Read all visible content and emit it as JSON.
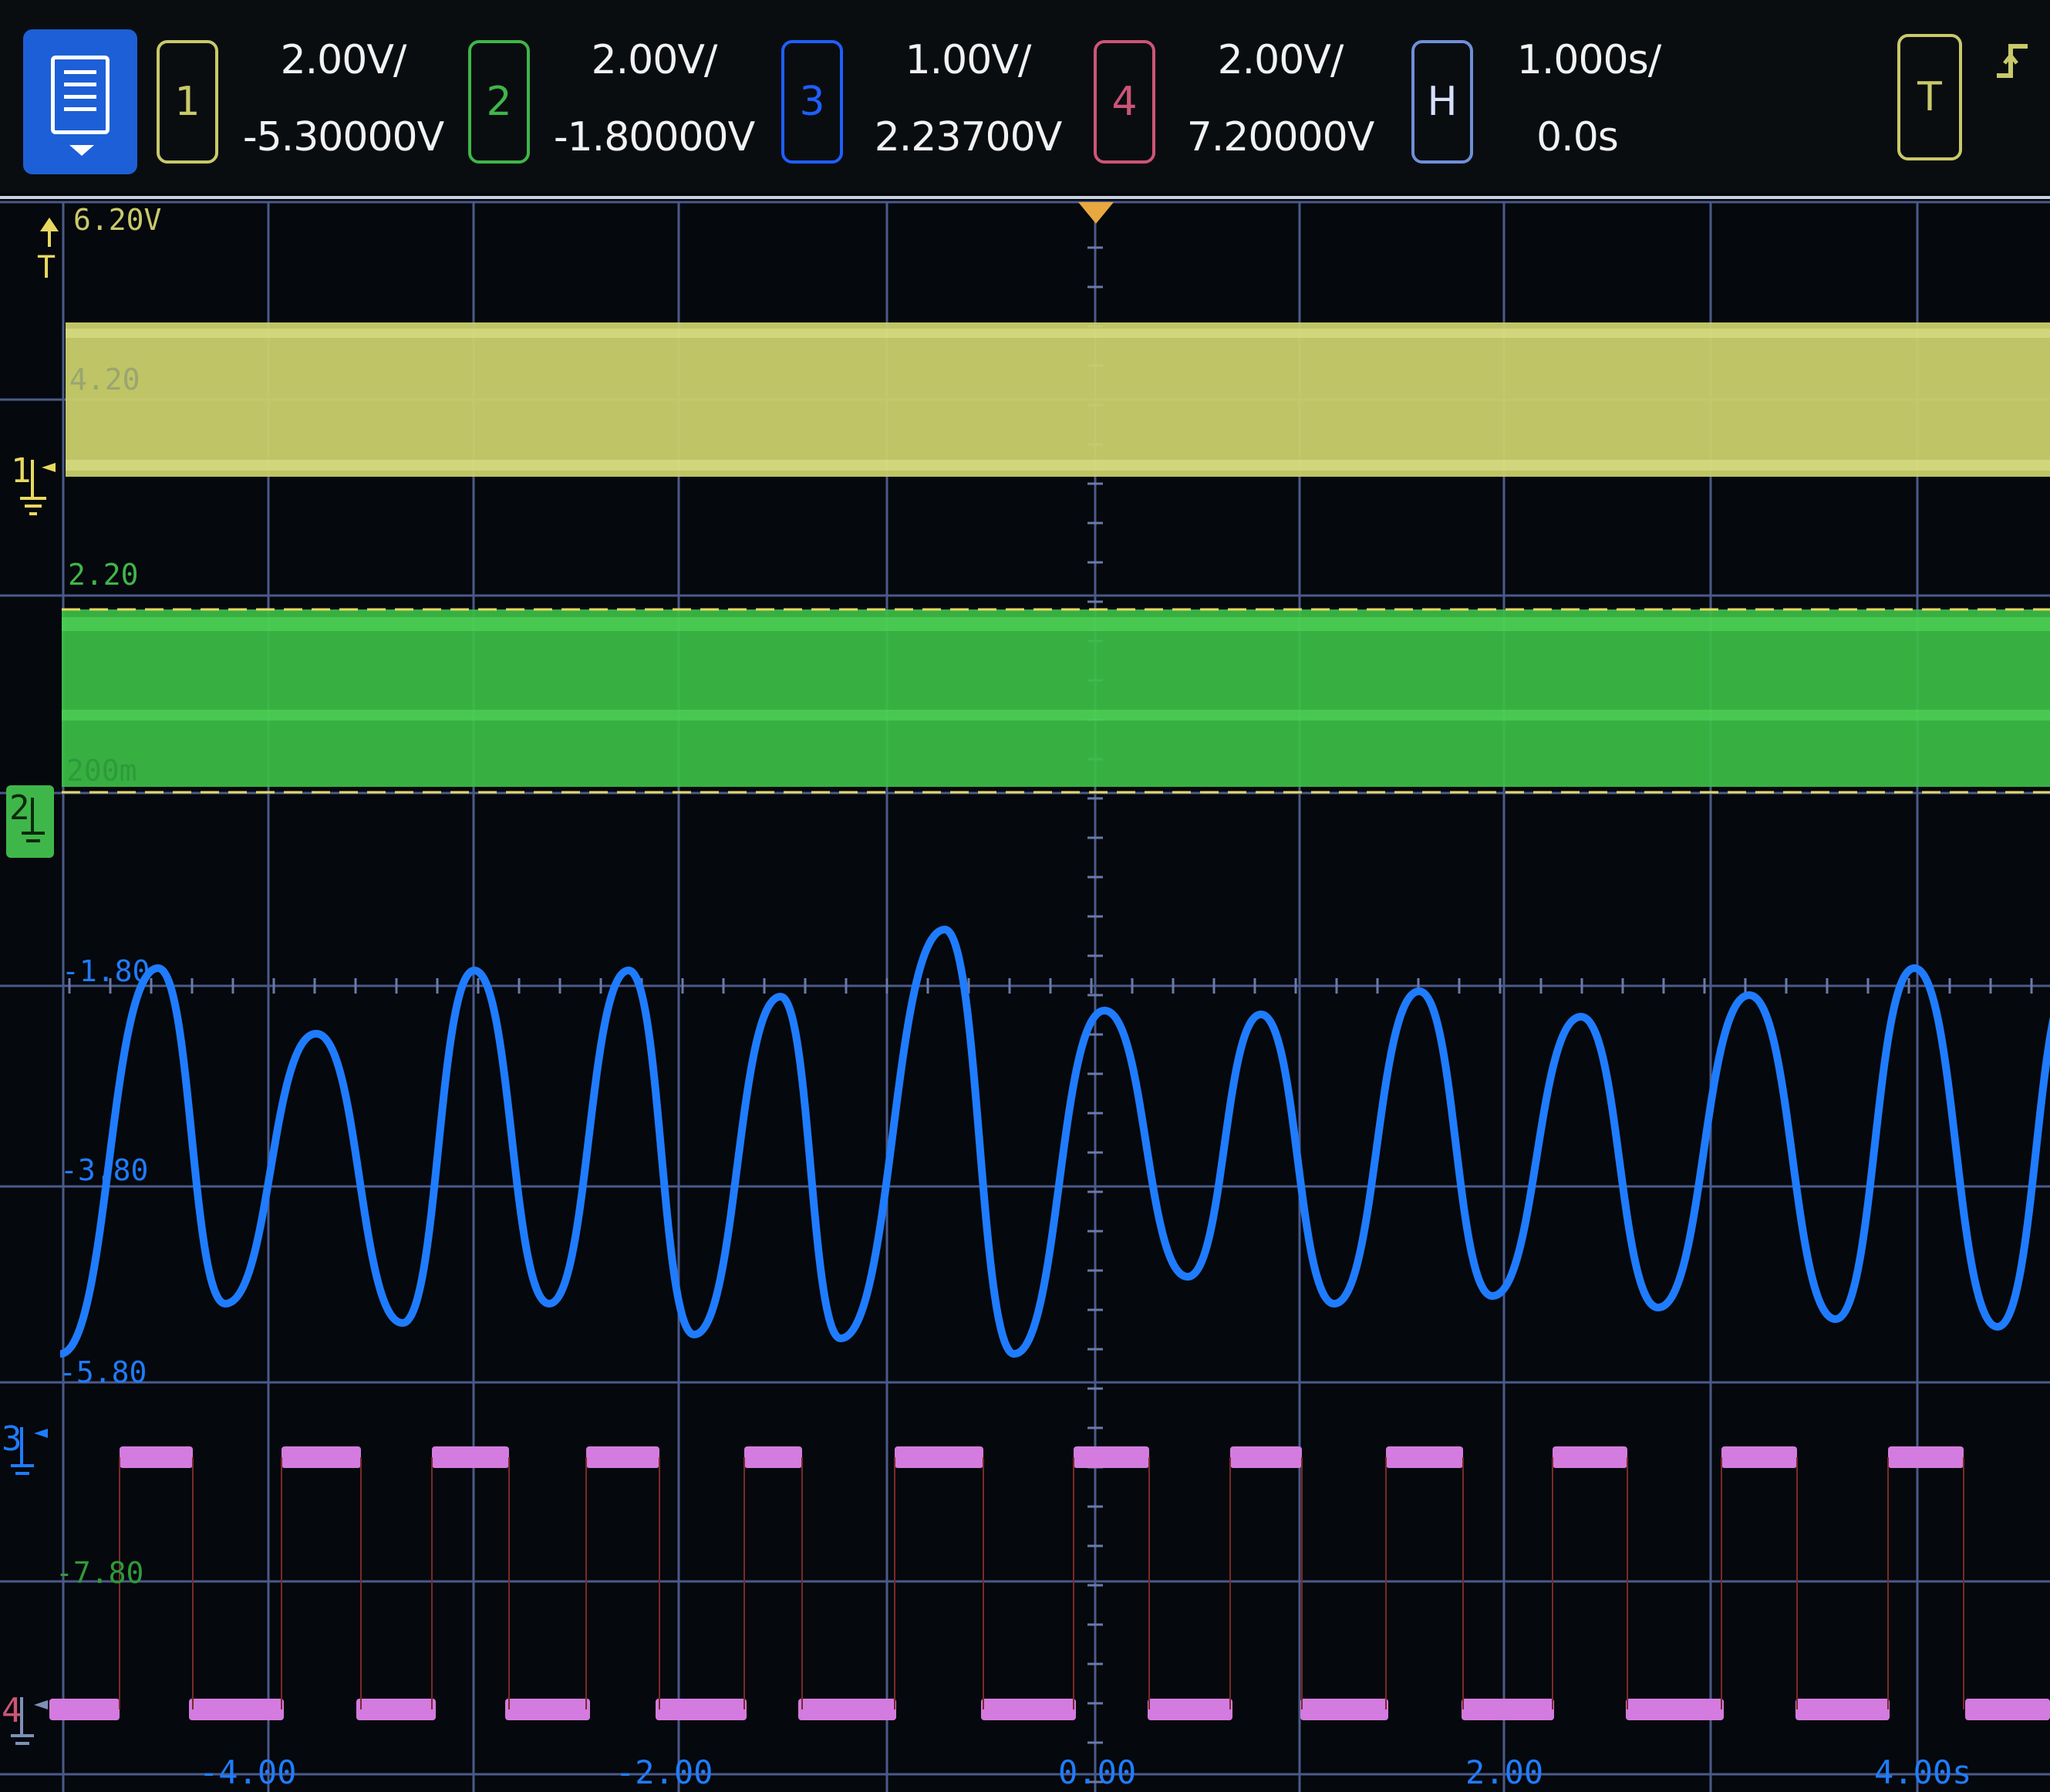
{
  "channels": [
    {
      "id": "1",
      "scale": "2.00V/",
      "offset": "-5.30000V",
      "color": "#c9c96a"
    },
    {
      "id": "2",
      "scale": "2.00V/",
      "offset": "-1.80000V",
      "color": "#3fb64a"
    },
    {
      "id": "3",
      "scale": "1.00V/",
      "offset": "2.23700V",
      "color": "#1f5fff"
    },
    {
      "id": "4",
      "scale": "2.00V/",
      "offset": "7.20000V",
      "color": "#cc5577"
    }
  ],
  "horizontal": {
    "label": "H",
    "scale": "1.000s/",
    "position": "0.0s",
    "color": "#6f8fd8"
  },
  "trigger": {
    "label": "T",
    "color": "#c9c96a"
  },
  "y_labels": [
    "6.20V",
    "4.20",
    "2.20",
    "200m",
    "-1.80",
    "-3.80",
    "-5.80",
    "-7.80"
  ],
  "x_labels": [
    "-4.00",
    "-2.00",
    "0.00",
    "2.00",
    "4.00s"
  ],
  "markers": {
    "ch1": "1",
    "ch2": "2",
    "ch3": "3",
    "ch4": "4",
    "trig": "T"
  },
  "icons": {
    "menu": "menu-icon",
    "edge": "rising-edge-icon"
  }
}
